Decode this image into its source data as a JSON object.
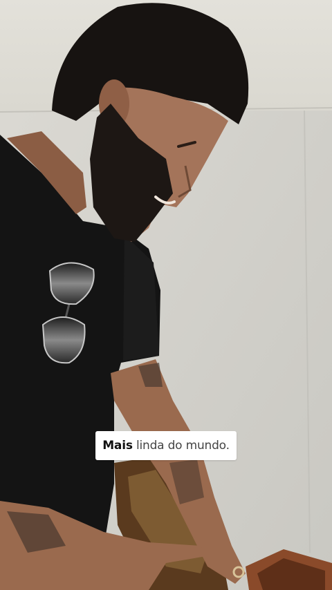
{
  "caption": {
    "highlight": "Mais",
    "rest": " linda do mundo."
  },
  "colors": {
    "wall": "#d9d8d2",
    "shirt": "#141414",
    "skin": "#9a6a4e",
    "hair": "#171311",
    "caption_bg": "#ffffff"
  }
}
